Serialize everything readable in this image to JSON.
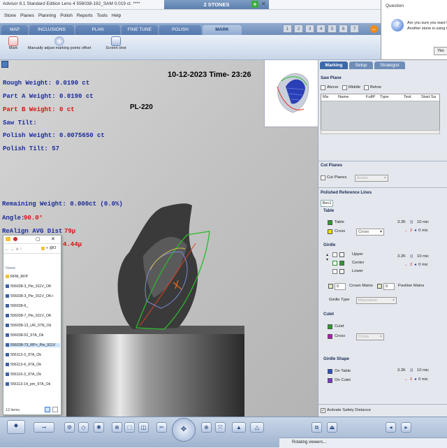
{
  "window": {
    "title": "Advisor 8.1 Standard Edition Lens 4    556038-192_SAM    0.019 ct. ****",
    "center_tab": "2 STONES",
    "add_symbol": "+",
    "close_symbol": "✕"
  },
  "menu": [
    "Stone",
    "Planes",
    "Planning",
    "Polish",
    "Reports",
    "Tools",
    "Help"
  ],
  "main_tabs": [
    "MAP",
    "INCLUSIONS",
    "PLAN",
    "FINE TUNE",
    "POLISH",
    "MARK"
  ],
  "active_main_tab": "MARK",
  "pages": [
    "1",
    "2",
    "3",
    "4",
    "5",
    "6",
    "7"
  ],
  "toolbar": {
    "mark_label": "Mark",
    "adjust_label": "Manually adjust marking points offset",
    "screenshot_label": "Screen shot"
  },
  "question_dialog": {
    "title": "Question",
    "icon": "?",
    "message_line1": "Are you sure you want to",
    "message_line2": "Another stone is using t",
    "yes_button": "Yes"
  },
  "viewer": {
    "datetime": "10-12-2023 Time- 23:26",
    "plan_label": "PL-220",
    "rough_weight": "Rough Weight: 0.0190 ct",
    "part_a_weight": "Part A Weight: 0.0190 ct",
    "part_b_weight": "Part B Weight: 0 ct",
    "saw_tilt": "Saw Tilt:",
    "polish_weight": "Polish Weight: 0.0075650 ct",
    "polish_tilt": "Polish Tilt: 57",
    "remaining_weight": "Remaining Weight: 0.000ct (0.0%)",
    "angle": "Angle:",
    "angle_value": "90.0°",
    "realign": "ReAlign AVG Dist",
    "realign_value": "79µ",
    "dist2_value": "4.44µ"
  },
  "explorer": {
    "path": "« @O",
    "column_header": "Name",
    "files": [
      "RFM_RFP",
      "556038-3_Pie_911V_OK",
      "556038-3_Pie_911V_OK+",
      "556038-6_",
      "556038-7_Pie_911V_OK",
      "556038-13_UR_97N_Ok",
      "556038-52_97A_Ok",
      "556038-73_RP+_Pie_911V",
      "556113-3_97A_Ok",
      "556113-4_97A_Ok",
      "556116-3_97A_Ok",
      "556113-14_pm_97A_Ok"
    ],
    "count": "12 items"
  },
  "panel": {
    "tabs": [
      "Marking",
      "Setup",
      "Strategist"
    ],
    "active_tab": "Marking",
    "saw_plane": {
      "title": "Saw Plane",
      "checks": [
        "Above",
        "Middle",
        "Below"
      ],
      "columns": [
        "Ma",
        "Name",
        "FullP",
        "Type",
        "Test",
        "Start Sa"
      ]
    },
    "cut_planes": {
      "title": "Cut Planes",
      "check_label": "Cut Planes",
      "dropdown": "Active"
    },
    "polished_reference_lines": {
      "title": "Polished Reference Lines",
      "subtab": "Rec1",
      "table": {
        "title": "Table",
        "rows": [
          {
            "label": "Table",
            "color": "#2e9a2e"
          },
          {
            "label": "Cross",
            "color": "#f0e000",
            "dropdown": "Cross"
          }
        ],
        "value_top": "3.2K",
        "value_top_unit": "10 mic",
        "value_bottom": "2",
        "value_bottom_unit": "0 mic"
      },
      "girdle": {
        "title": "Girdle",
        "rows": [
          {
            "label": "Upper",
            "color": "#ffffff"
          },
          {
            "label": "Center",
            "color": "#2e9a2e"
          },
          {
            "label": "Lower",
            "color": "#ffffff"
          }
        ],
        "value_top": "3.2K",
        "value_top_unit": "10 mic",
        "value_bottom": "2",
        "value_bottom_unit": "0 mic",
        "crown_mains_value": "0",
        "crown_mains": "Crown Mains",
        "pavilion_mains_value": "0",
        "pavilion_mains": "Pavilion Mains",
        "girdle_type_label": "Girdle Type",
        "girdle_type": "Mountains"
      },
      "culet": {
        "title": "Culet",
        "rows": [
          {
            "label": "Culet",
            "color": "#2e9a2e"
          },
          {
            "label": "Cross",
            "color": "#b01ab0",
            "dropdown": "Cross"
          }
        ]
      },
      "girdle_shape": {
        "title": "Girdle Shape",
        "rows": [
          {
            "label": "On Table",
            "color": "#2c4ec4"
          },
          {
            "label": "On Culet",
            "color": "#7a38c8"
          }
        ],
        "value_top": "3.2K",
        "value_top_unit": "10 mic",
        "value_bottom": "2",
        "value_bottom_unit": "0 mic"
      }
    },
    "safety": "Activate Safety Distance"
  },
  "status": {
    "text": "Rotating viewers..."
  }
}
